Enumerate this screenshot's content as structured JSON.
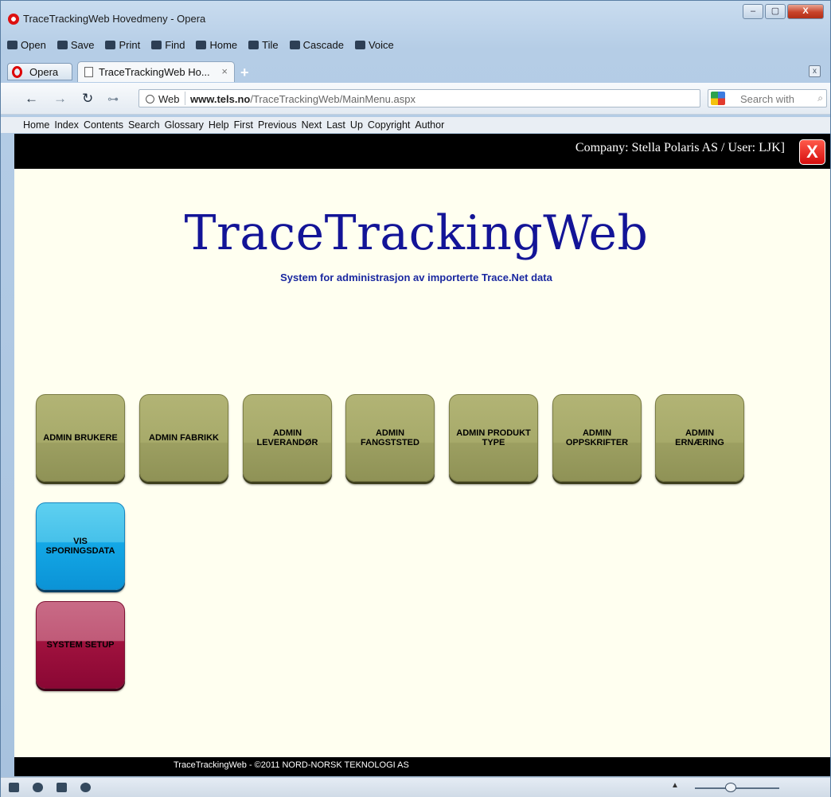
{
  "window": {
    "title": "TraceTrackingWeb Hovedmeny - Opera",
    "controls": [
      "–",
      "▢",
      "X"
    ]
  },
  "toolbar": {
    "items": [
      {
        "label": "Open",
        "icon": "folder-icon"
      },
      {
        "label": "Save",
        "icon": "save-icon"
      },
      {
        "label": "Print",
        "icon": "print-icon"
      },
      {
        "label": "Find",
        "icon": "search-icon"
      },
      {
        "label": "Home",
        "icon": "home-icon"
      },
      {
        "label": "Tile",
        "icon": "tile-icon"
      },
      {
        "label": "Cascade",
        "icon": "cascade-icon"
      },
      {
        "label": "Voice",
        "icon": "microphone-icon"
      }
    ]
  },
  "tabs": {
    "menu_label": "Opera",
    "active_tab": "TraceTrackingWeb Ho...",
    "close_glyph": "×",
    "new_tab_glyph": "+"
  },
  "address": {
    "web_label": "Web",
    "url_domain": "www.tels.no",
    "url_path": "/TraceTrackingWeb/MainMenu.aspx",
    "search_placeholder": "Search with"
  },
  "navbar": [
    "Home",
    "Index",
    "Contents",
    "Search",
    "Glossary",
    "Help",
    "First",
    "Previous",
    "Next",
    "Last",
    "Up",
    "Copyright",
    "Author"
  ],
  "page": {
    "company_user": "Company: Stella Polaris AS / User: LJK]",
    "logout_glyph": "X",
    "title": "TraceTrackingWeb",
    "subtitle": "System for administrasjon av importerte Trace.Net data",
    "tiles_row1": [
      {
        "line1": "ADMIN BRUKERE",
        "line2": ""
      },
      {
        "line1": "ADMIN FABRIKK",
        "line2": ""
      },
      {
        "line1": "ADMIN",
        "line2": "LEVERANDØR"
      },
      {
        "line1": "ADMIN",
        "line2": "FANGSTSTED"
      },
      {
        "line1": "ADMIN PRODUKT",
        "line2": "TYPE"
      },
      {
        "line1": "ADMIN",
        "line2": "OPPSKRIFTER"
      },
      {
        "line1": "ADMIN",
        "line2": "ERNÆRING"
      }
    ],
    "tile_vis": {
      "line1": "VIS",
      "line2": "SPORINGSDATA"
    },
    "tile_setup": {
      "line1": "SYSTEM SETUP"
    },
    "colors": {
      "olive": "#a7aa6a",
      "blue": "#14a8e6",
      "red": "#a0123e",
      "title": "#131497",
      "background": "#fffff0"
    },
    "footer": "TraceTrackingWeb - ©2011 NORD-NORSK TEKNOLOGI AS"
  }
}
